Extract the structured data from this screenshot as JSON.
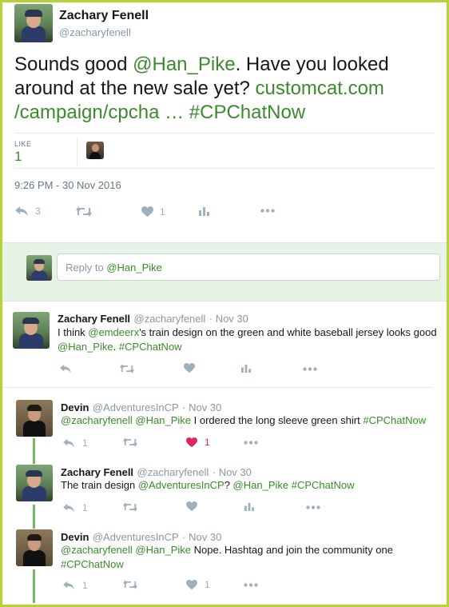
{
  "main_tweet": {
    "name": "Zachary Fenell",
    "handle": "@zacharyfenell",
    "text_1": "Sounds good ",
    "mention": "@Han_Pike",
    "text_2": ". Have you looked around at the new sale yet? ",
    "link": "customcat.com /campaign/cpcha …",
    "hashtag": " #CPChatNow",
    "like_label": "LIKE",
    "like_count": "1",
    "timestamp": "9:26 PM - 30 Nov 2016",
    "reply_count": "3",
    "favorite_count": "1"
  },
  "reply_box": {
    "placeholder": "Reply to ",
    "mention": "@Han_Pike"
  },
  "replies": [
    {
      "name": "Zachary Fenell",
      "handle": "@zacharyfenell",
      "date": "· Nov 30",
      "text_1": "I think ",
      "mention_1": "@emdeerx",
      "text_2": "'s train design on the green and white baseball jersey looks good",
      "mention_2": "@Han_Pike",
      "text_3": ". ",
      "hashtag": "#CPChatNow"
    },
    {
      "name": "Devin",
      "handle": "@AdventuresInCP",
      "date": "· Nov 30",
      "mention_1": "@zacharyfenell",
      "mention_2": "@Han_Pike",
      "text_1": " I ordered the long sleeve green shirt ",
      "hashtag": "#CPChatNow",
      "reply_count": "1",
      "like_count": "1"
    },
    {
      "name": "Zachary Fenell",
      "handle": "@zacharyfenell",
      "date": "· Nov 30",
      "text_1": "The train design ",
      "mention_1": "@AdventuresInCP",
      "text_2": "? ",
      "mention_2": "@Han_Pike",
      "hashtag": " #CPChatNow",
      "reply_count": "1"
    },
    {
      "name": "Devin",
      "handle": "@AdventuresInCP",
      "date": "· Nov 30",
      "mention_1": "@zacharyfenell",
      "mention_2": "@Han_Pike",
      "text_1": " Nope. Hashtag and join the community one",
      "hashtag": "#CPChatNow",
      "reply_count": "1",
      "like_count": "1"
    }
  ],
  "icons": {
    "reply": "reply-icon",
    "retweet": "retweet-icon",
    "like": "heart-icon",
    "analytics": "analytics-icon",
    "more": "more-icon"
  },
  "colors": {
    "frame": "#b5d334",
    "link": "#3b8a2e",
    "liked": "#e0245e",
    "thread_line": "#78b569"
  }
}
